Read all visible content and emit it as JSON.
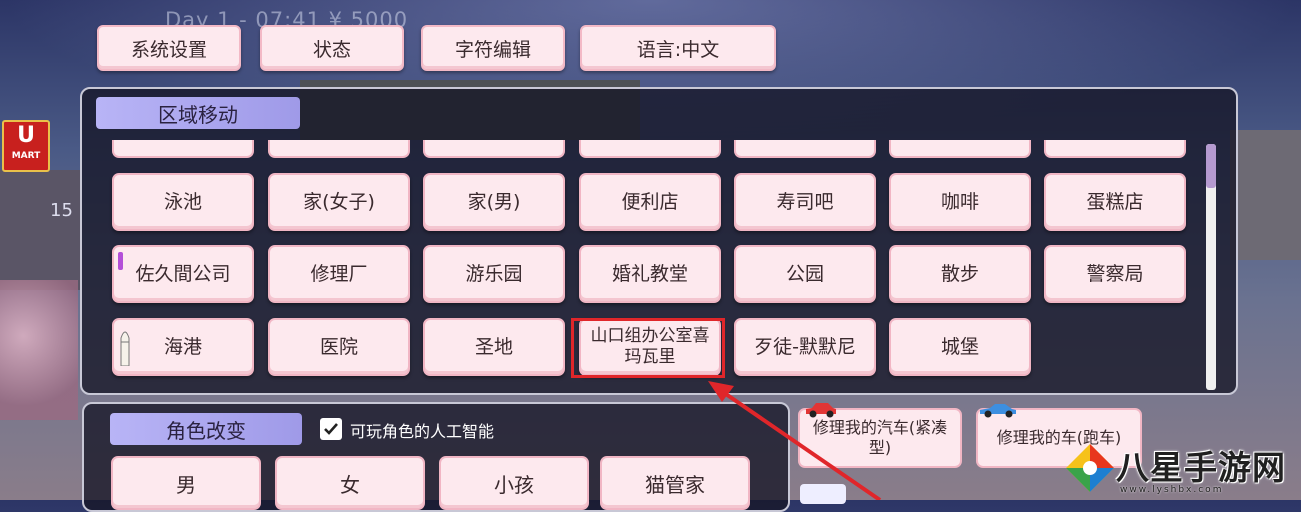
{
  "hud": {
    "status_line": "Day 1 - 07:41  ¥ 5000"
  },
  "top_menu": [
    {
      "label": "系统设置"
    },
    {
      "label": "状态"
    },
    {
      "label": "字符编辑"
    },
    {
      "label": "语言:中文"
    }
  ],
  "area_panel": {
    "title": "区域移动",
    "rows": [
      [
        "泳池",
        "家(女子)",
        "家(男)",
        "便利店",
        "寿司吧",
        "咖啡",
        "蛋糕店"
      ],
      [
        "佐久間公司",
        "修理厂",
        "游乐园",
        "婚礼教堂",
        "公园",
        "散步",
        "警察局"
      ],
      [
        "海港",
        "医院",
        "圣地",
        "山口组办公室喜玛瓦里",
        "歹徒-默默尼",
        "城堡"
      ]
    ]
  },
  "character_panel": {
    "title": "角色改变",
    "ai_checkbox_label": "可玩角色的人工智能",
    "ai_checkbox_checked": true,
    "buttons": [
      "男",
      "女",
      "小孩",
      "猫管家"
    ]
  },
  "repair_buttons": [
    {
      "label": "修理我的汽车(紧凑型)",
      "icon": "car-red-icon"
    },
    {
      "label": "修理我的车(跑车)",
      "icon": "car-blue-icon"
    }
  ],
  "background": {
    "store_sign": "U",
    "store_sign_sub": "MART",
    "street_number": "15"
  },
  "watermark": {
    "text": "八星手游网",
    "url": "www.lyshbx.com"
  },
  "colors": {
    "button_bg": "#fde9ee",
    "title_bg": "#b8b4f6",
    "highlight": "#e0262a"
  }
}
